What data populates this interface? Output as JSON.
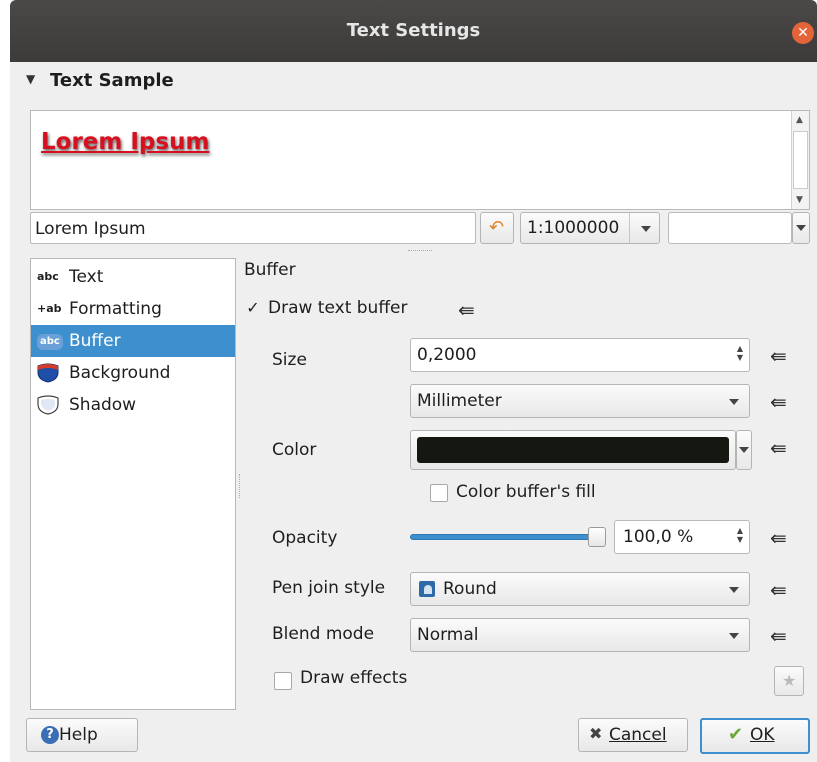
{
  "window": {
    "title": "Text Settings",
    "close_glyph": "✕"
  },
  "text_sample": {
    "header": "Text Sample",
    "preview_text": "Lorem Ipsum",
    "input_value": "Lorem Ipsum",
    "scale_value": "1:1000000"
  },
  "sidebar": {
    "items": [
      {
        "icon_text": "abc",
        "label": "Text"
      },
      {
        "icon_text": "+ab",
        "label": "Formatting"
      },
      {
        "icon_text": "abc",
        "label": "Buffer"
      },
      {
        "icon_text": "",
        "label": "Background"
      },
      {
        "icon_text": "",
        "label": "Shadow"
      }
    ],
    "selected_index": 2
  },
  "buffer": {
    "section_title": "Buffer",
    "draw_text_buffer": {
      "label": "Draw text buffer",
      "checked": true
    },
    "size": {
      "label": "Size",
      "value": "0,2000",
      "unit": "Millimeter"
    },
    "color": {
      "label": "Color",
      "value_color": "#141811",
      "fill_label": "Color buffer's fill",
      "fill_checked": false
    },
    "opacity": {
      "label": "Opacity",
      "value": "100,0 %",
      "level": 1.0
    },
    "pen_join": {
      "label": "Pen join style",
      "value": "Round"
    },
    "blend": {
      "label": "Blend mode",
      "value": "Normal"
    },
    "draw_effects": {
      "label": "Draw effects",
      "checked": false
    }
  },
  "footer": {
    "help_label": "Help",
    "cancel_label": "Cancel",
    "ok_label": "OK"
  },
  "colors": {
    "accent": "#3d8fce",
    "titlebar": "#403f3d",
    "preview_red": "#d6101e",
    "slider": "#3d8fce"
  }
}
